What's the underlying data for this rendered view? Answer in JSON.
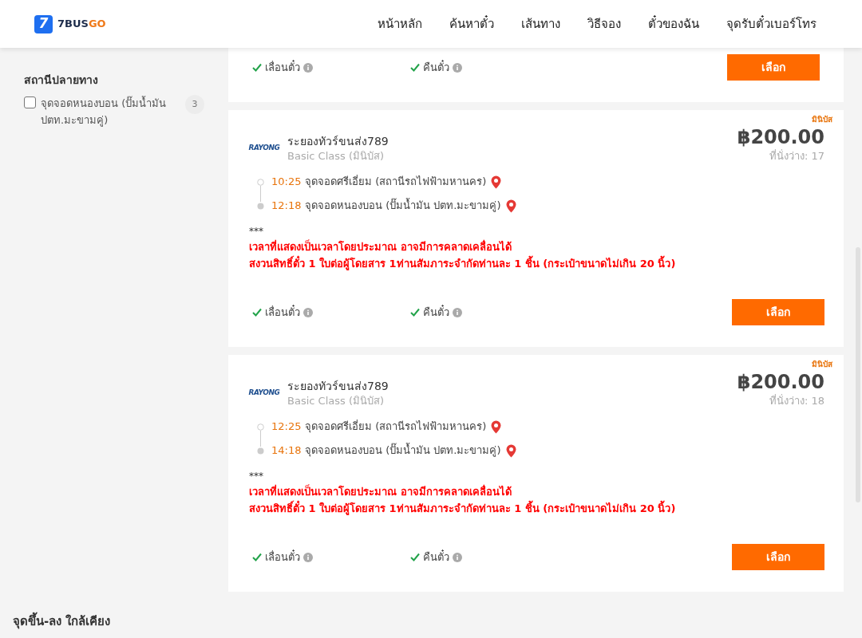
{
  "header": {
    "logo": {
      "mark": "7",
      "name": "7BUS",
      "name_accent": "GO"
    },
    "nav": [
      {
        "label": "หน้าหลัก"
      },
      {
        "label": "ค้นหาตั๋ว"
      },
      {
        "label": "เส้นทาง"
      },
      {
        "label": "วิธีจอง"
      },
      {
        "label": "ตั๋วของฉัน"
      },
      {
        "label": "จุดรับตั๋วเบอร์โทร"
      }
    ]
  },
  "sidebar": {
    "filter_group": {
      "title": "สถานีปลายทาง",
      "options": [
        {
          "label": "จุดจอดหนองบอน (ปั๊มน้ำมัน ปตท.มะขามคู่)",
          "count": "3",
          "checked": false
        }
      ]
    }
  },
  "results": [
    {
      "kind": "partial",
      "features": [
        {
          "label": "เลื่อนตั๋ว",
          "available": true
        },
        {
          "label": "คืนตั๋ว",
          "available": true
        }
      ],
      "button": "เลือก"
    },
    {
      "kind": "full",
      "badge": "มินิบัส",
      "operator": {
        "logo_text": "RAYONG",
        "name": "ระยองทัวร์ขนส่ง789",
        "class": "Basic Class (มินิบัส)"
      },
      "price": "฿200.00",
      "seats": "ที่นั่งว่าง: 17",
      "stops": [
        {
          "kind": "origin",
          "time": "10:25",
          "name": "จุดจอดศรีเอี่ยม (สถานีรถไฟฟ้ามหานคร)"
        },
        {
          "kind": "destination",
          "time": "12:18",
          "name": "จุดจอดหนองบอน (ปั๊มน้ำมัน ปตท.มะขามคู่)"
        }
      ],
      "note_mark": "***",
      "notes": [
        "เวลาที่แสดงเป็นเวลาโดยประมาณ อาจมีการคลาดเคลื่อนได้",
        "สงวนสิทธิ์ตั๋ว 1 ใบต่อผู้โดยสาร 1ท่านสัมภาระจำกัดท่านละ 1 ชิ้น (กระเป๋าขนาดไม่เกิน 20 นิ้ว)"
      ],
      "features": [
        {
          "label": "เลื่อนตั๋ว",
          "available": true
        },
        {
          "label": "คืนตั๋ว",
          "available": true
        }
      ],
      "button": "เลือก"
    },
    {
      "kind": "full",
      "badge": "มินิบัส",
      "operator": {
        "logo_text": "RAYONG",
        "name": "ระยองทัวร์ขนส่ง789",
        "class": "Basic Class (มินิบัส)"
      },
      "price": "฿200.00",
      "seats": "ที่นั่งว่าง: 18",
      "stops": [
        {
          "kind": "origin",
          "time": "12:25",
          "name": "จุดจอดศรีเอี่ยม (สถานีรถไฟฟ้ามหานคร)"
        },
        {
          "kind": "destination",
          "time": "14:18",
          "name": "จุดจอดหนองบอน (ปั๊มน้ำมัน ปตท.มะขามคู่)"
        }
      ],
      "note_mark": "***",
      "notes": [
        "เวลาที่แสดงเป็นเวลาโดยประมาณ อาจมีการคลาดเคลื่อนได้",
        "สงวนสิทธิ์ตั๋ว 1 ใบต่อผู้โดยสาร 1ท่านสัมภาระจำกัดท่านละ 1 ชิ้น (กระเป๋าขนาดไม่เกิน 20 นิ้ว)"
      ],
      "features": [
        {
          "label": "เลื่อนตั๋ว",
          "available": true
        },
        {
          "label": "คืนตั๋ว",
          "available": true
        }
      ],
      "button": "เลือก"
    }
  ],
  "nearby": {
    "title": "จุดขึ้น-ลง ใกล้เคียง"
  }
}
